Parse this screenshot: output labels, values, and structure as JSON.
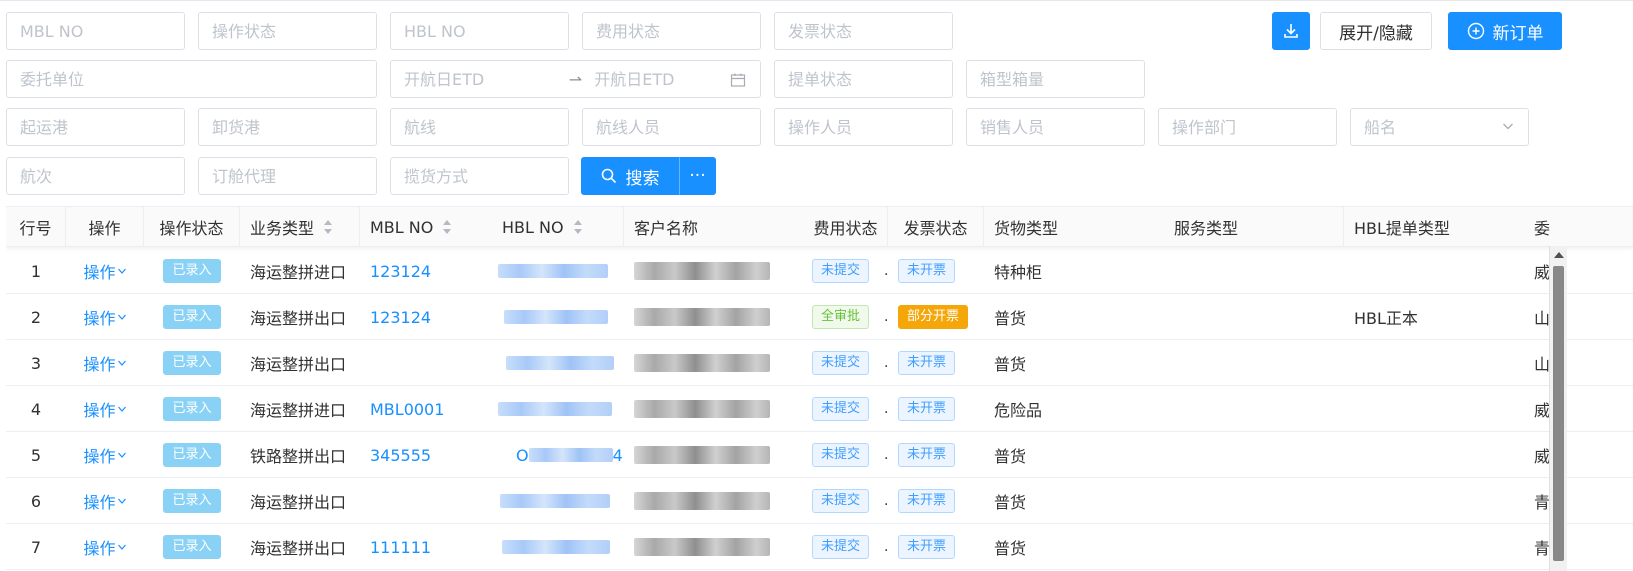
{
  "filters": {
    "mbl_no": "MBL NO",
    "op_status": "操作状态",
    "hbl_no": "HBL NO",
    "fee_status": "费用状态",
    "invoice_status": "发票状态",
    "client": "委托单位",
    "etd_start": "开航日ETD",
    "etd_end": "开航日ETD",
    "bl_status": "提单状态",
    "container_qty": "箱型箱量",
    "pol": "起运港",
    "pod": "卸货港",
    "route": "航线",
    "route_staff": "航线人员",
    "operator": "操作人员",
    "sales": "销售人员",
    "op_dept": "操作部门",
    "vessel": "船名",
    "voyage": "航次",
    "booking_agent": "订舱代理",
    "cargo_method": "揽货方式"
  },
  "buttons": {
    "toggle": "展开/隐藏",
    "new_order": "新订单",
    "search": "搜索",
    "more": "···"
  },
  "table": {
    "headers": {
      "row_no": "行号",
      "action": "操作",
      "op_status": "操作状态",
      "biz_type": "业务类型",
      "mbl_no": "MBL NO",
      "hbl_no": "HBL NO",
      "customer": "客户名称",
      "fee_status": "费用状态",
      "invoice_status": "发票状态",
      "cargo_type": "货物类型",
      "service_type": "服务类型",
      "hbl_bl_type": "HBL提单类型",
      "client_short": "委"
    },
    "rows": [
      {
        "no": "1",
        "action": "操作",
        "status": "已录入",
        "biz": "海运整拼进口",
        "mbl": "123124",
        "hbl_prefix": "",
        "hbl_suffix": "",
        "fee": "未提交",
        "dot": ".",
        "invoice": "未开票",
        "cargo": "特种柜",
        "bl_type": "",
        "client": "威"
      },
      {
        "no": "2",
        "action": "操作",
        "status": "已录入",
        "biz": "海运整拼出口",
        "mbl": "123124",
        "hbl_prefix": "",
        "hbl_suffix": "",
        "fee": "全审批",
        "dot": ".",
        "invoice": "部分开票",
        "cargo": "普货",
        "bl_type": "HBL正本",
        "client": "山"
      },
      {
        "no": "3",
        "action": "操作",
        "status": "已录入",
        "biz": "海运整拼出口",
        "mbl": "",
        "hbl_prefix": "",
        "hbl_suffix": "",
        "fee": "未提交",
        "dot": ".",
        "invoice": "未开票",
        "cargo": "普货",
        "bl_type": "",
        "client": "山"
      },
      {
        "no": "4",
        "action": "操作",
        "status": "已录入",
        "biz": "海运整拼进口",
        "mbl": "MBL0001",
        "hbl_prefix": "",
        "hbl_suffix": "",
        "fee": "未提交",
        "dot": ".",
        "invoice": "未开票",
        "cargo": "危险品",
        "bl_type": "",
        "client": "威"
      },
      {
        "no": "5",
        "action": "操作",
        "status": "已录入",
        "biz": "铁路整拼出口",
        "mbl": "345555",
        "hbl_prefix": "O",
        "hbl_suffix": "4",
        "fee": "未提交",
        "dot": ".",
        "invoice": "未开票",
        "cargo": "普货",
        "bl_type": "",
        "client": "威"
      },
      {
        "no": "6",
        "action": "操作",
        "status": "已录入",
        "biz": "海运整拼出口",
        "mbl": "",
        "hbl_prefix": "",
        "hbl_suffix": "",
        "fee": "未提交",
        "dot": ".",
        "invoice": "未开票",
        "cargo": "普货",
        "bl_type": "",
        "client": "青"
      },
      {
        "no": "7",
        "action": "操作",
        "status": "已录入",
        "biz": "海运整拼出口",
        "mbl": "111111",
        "hbl_prefix": "",
        "hbl_suffix": "",
        "fee": "未提交",
        "dot": ".",
        "invoice": "未开票",
        "cargo": "普货",
        "bl_type": "",
        "client": "青"
      }
    ]
  },
  "colors": {
    "primary": "#1890ff",
    "entered_tag": "#89d2f5",
    "partial_invoice": "#f5a70a"
  }
}
